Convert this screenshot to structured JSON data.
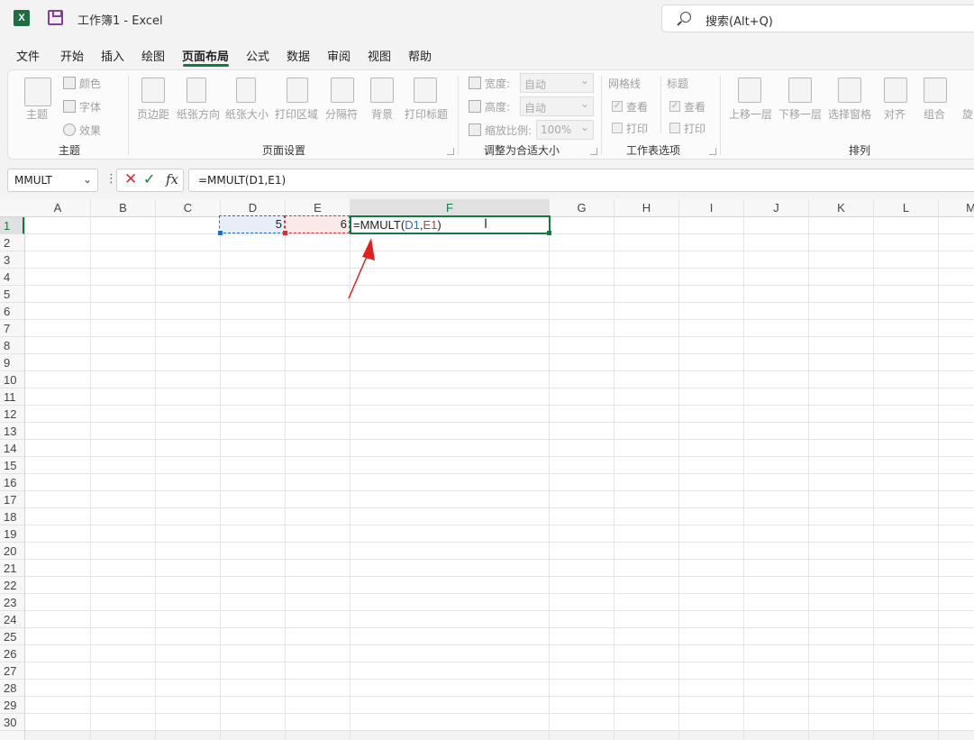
{
  "titlebar": {
    "app_icon": "excel-icon",
    "save_icon": "save-icon",
    "title": "工作簿1  -  Excel",
    "search_placeholder": "搜索(Alt+Q)"
  },
  "menu_tabs": [
    "文件",
    "开始",
    "插入",
    "绘图",
    "页面布局",
    "公式",
    "数据",
    "审阅",
    "视图",
    "帮助"
  ],
  "active_tab": "页面布局",
  "ribbon": {
    "theme_group": {
      "label": "主题",
      "theme_button": "主题",
      "colors": "颜色",
      "fonts": "字体",
      "effects": "效果"
    },
    "page_setup_group": {
      "label": "页面设置",
      "buttons": [
        "页边距",
        "纸张方向",
        "纸张大小",
        "打印区域",
        "分隔符",
        "背景",
        "打印标题"
      ]
    },
    "scale_group": {
      "label": "调整为合适大小",
      "width_label": "宽度:",
      "width_value": "自动",
      "height_label": "高度:",
      "height_value": "自动",
      "scale_label": "缩放比例:",
      "scale_value": "100%"
    },
    "sheet_options_group": {
      "label": "工作表选项",
      "gridlines": "网格线",
      "headings": "标题",
      "view": "查看",
      "print": "打印"
    },
    "arrange_group": {
      "label": "排列",
      "buttons": [
        "上移一层",
        "下移一层",
        "选择窗格",
        "对齐",
        "组合",
        "旋"
      ]
    }
  },
  "formula_bar": {
    "name_box": "MMULT",
    "formula": "=MMULT(D1,E1)",
    "fx": "fx"
  },
  "grid": {
    "columns": [
      "A",
      "B",
      "C",
      "D",
      "E",
      "F",
      "G",
      "H",
      "I",
      "J",
      "K",
      "L",
      "M"
    ],
    "rows": [
      "1",
      "2",
      "3",
      "4",
      "5",
      "6",
      "7",
      "8",
      "9",
      "10",
      "11",
      "12",
      "13",
      "14",
      "15",
      "16",
      "17",
      "18",
      "19",
      "20",
      "21",
      "22",
      "23",
      "24",
      "25",
      "26",
      "27",
      "28",
      "29",
      "30"
    ],
    "cells": {
      "D1": "5",
      "E1": "6",
      "F1_prefix": "=MMULT(",
      "F1_ref1": "D1",
      "F1_comma": ",",
      "F1_ref2": "E1",
      "F1_suffix": ")"
    }
  },
  "colors": {
    "excel_green": "#107c41",
    "ref_blue": "#2a6ebb",
    "ref_red": "#c83737",
    "arrow_red": "#e02020"
  }
}
